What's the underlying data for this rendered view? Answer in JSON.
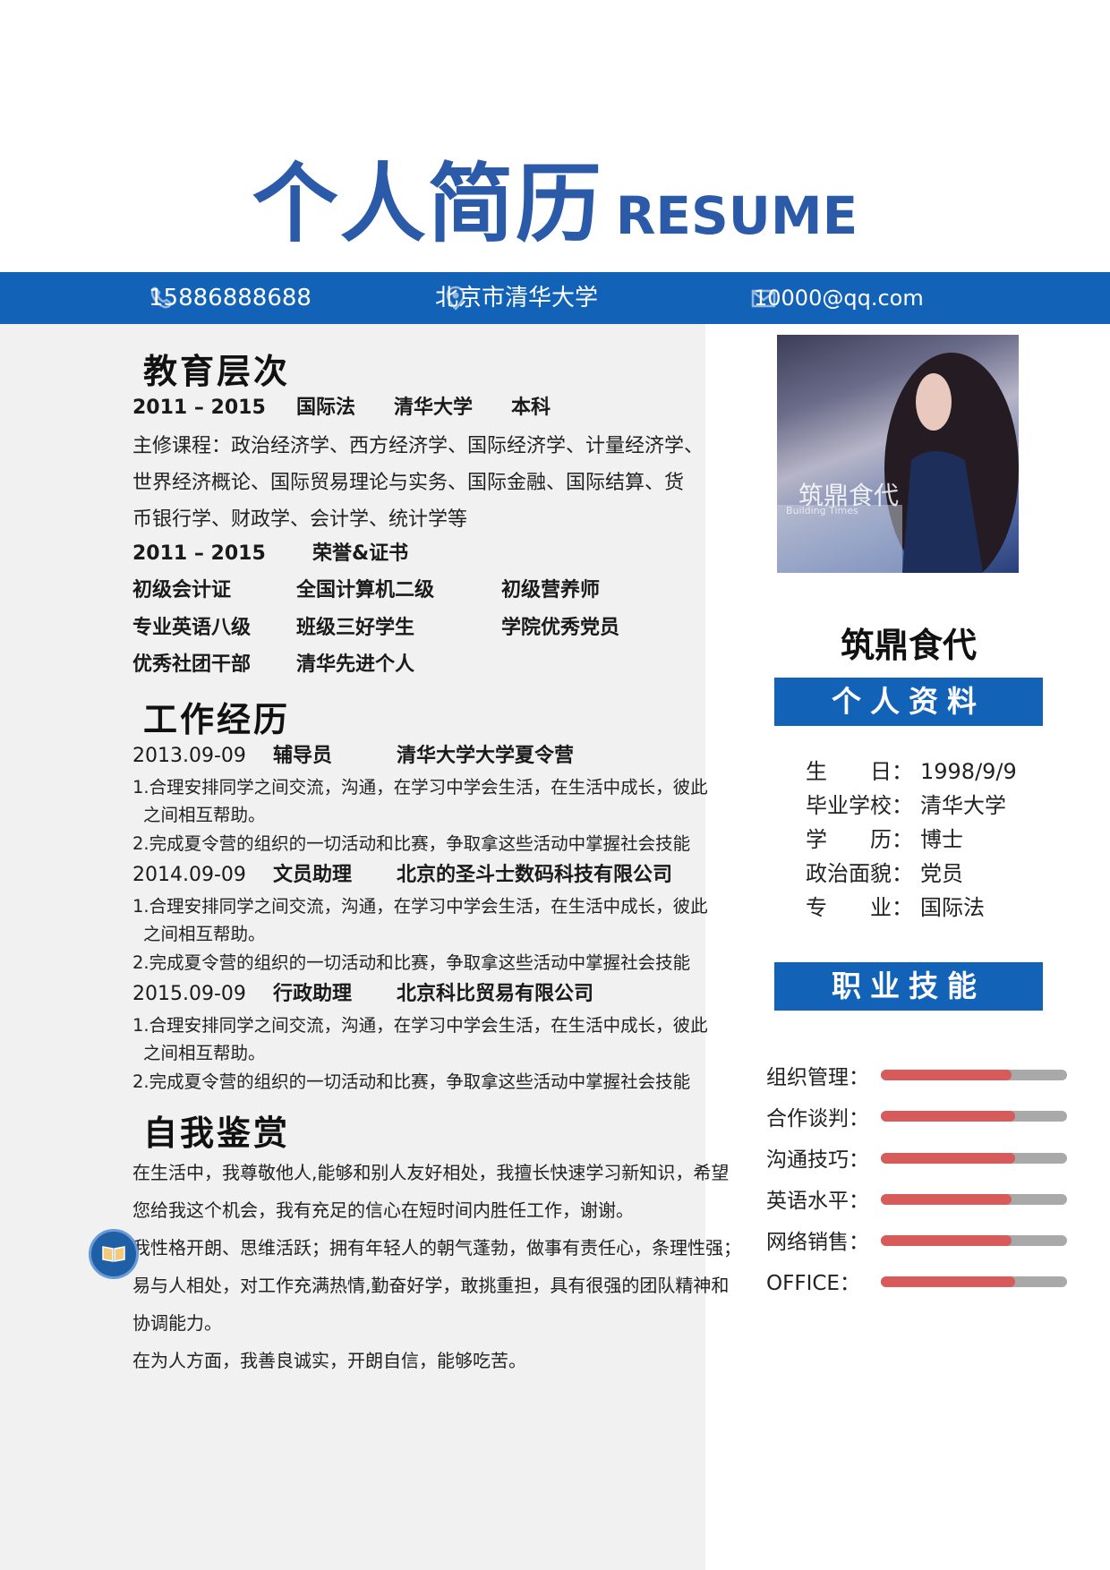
{
  "header": {
    "title_cn": "个人简历",
    "title_en": "RESUME"
  },
  "contact": {
    "phone": "15886888688",
    "address": "北京市清华大学",
    "email": "10000@qq.com",
    "phone_icon": "phone-icon",
    "address_icon": "location-pin-icon",
    "email_icon": "mail-icon"
  },
  "education": {
    "title": "教育层次",
    "period": "2011 – 2015",
    "major": "国际法",
    "school": "清华大学",
    "degree": "本科",
    "courses": [
      "主修课程：政治经济学、西方经济学、国际经济学、计量经济学、",
      "世界经济概论、国际贸易理论与实务、国际金融、国际结算、货",
      "币银行学、财政学、会计学、统计学等"
    ],
    "honors_period": "2011 – 2015",
    "honors_title": "荣誉&证书",
    "honors": [
      [
        "初级会计证",
        "全国计算机二级",
        "初级营养师"
      ],
      [
        "专业英语八级",
        "班级三好学生",
        "学院优秀党员"
      ],
      [
        "优秀社团干部",
        "清华先进个人"
      ]
    ]
  },
  "work": {
    "title": "工作经历",
    "items": [
      {
        "date": "2013.09-09",
        "role": "辅导员",
        "org": "清华大学大学夏令营",
        "lines": [
          "1.合理安排同学之间交流，沟通，在学习中学会生活，在生活中成长，彼此",
          "之间相互帮助。",
          "2.完成夏令营的组织的一切活动和比赛，争取拿这些活动中掌握社会技能"
        ]
      },
      {
        "date": "2014.09-09",
        "role": "文员助理",
        "org": "北京的圣斗士数码科技有限公司",
        "lines": [
          "1.合理安排同学之间交流，沟通，在学习中学会生活，在生活中成长，彼此",
          "之间相互帮助。",
          "2.完成夏令营的组织的一切活动和比赛，争取拿这些活动中掌握社会技能"
        ]
      },
      {
        "date": "2015.09-09",
        "role": "行政助理",
        "org": "北京科比贸易有限公司",
        "lines": [
          "1.合理安排同学之间交流，沟通，在学习中学会生活，在生活中成长，彼此",
          "之间相互帮助。",
          "2.完成夏令营的组织的一切活动和比赛，争取拿这些活动中掌握社会技能"
        ]
      }
    ]
  },
  "self": {
    "title": "自我鉴赏",
    "lines": [
      "在生活中，我尊敬他人,能够和别人友好相处，我擅长快速学习新知识，希望",
      "您给我这个机会，我有充足的信心在短时间内胜任工作，谢谢。",
      "我性格开朗、思维活跃；拥有年轻人的朝气蓬勃，做事有责任心，条理性强；",
      "易与人相处，对工作充满热情,勤奋好学，敢挑重担，具有很强的团队精神和",
      "协调能力。",
      "在为人方面，我善良诚实，开朗自信，能够吃苦。"
    ]
  },
  "profile": {
    "photo_text_cn": "筑鼎食代",
    "photo_text_en": "Building Times",
    "name": "筑鼎食代",
    "info_title": "个人资料",
    "info": [
      {
        "label": "生　　日：",
        "value": "1998/9/9"
      },
      {
        "label": "毕业学校：",
        "value": "清华大学"
      },
      {
        "label": "学　　历：",
        "value": "博士"
      },
      {
        "label": "政治面貌：",
        "value": "党员"
      },
      {
        "label": "专　　业：",
        "value": "国际法"
      }
    ]
  },
  "skills": {
    "title": "职业技能",
    "fill_color": "#d75b5b",
    "track_color": "#a9a9a9",
    "items": [
      {
        "label": "组织管理：",
        "level": 0.7
      },
      {
        "label": "合作谈判：",
        "level": 0.72
      },
      {
        "label": "沟通技巧：",
        "level": 0.72
      },
      {
        "label": "英语水平：",
        "level": 0.7
      },
      {
        "label": "网络销售：",
        "level": 0.7
      },
      {
        "label": "OFFICE：",
        "level": 0.72
      }
    ]
  },
  "badge_icon": "book-icon"
}
